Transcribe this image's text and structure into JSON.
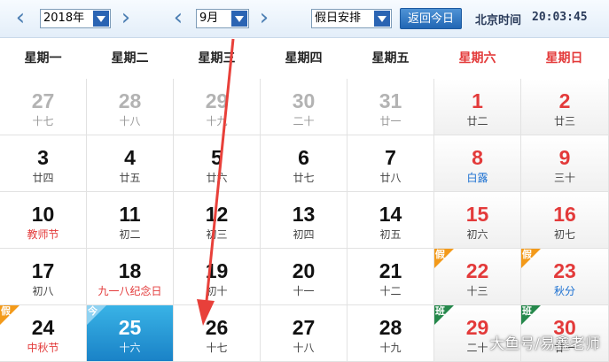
{
  "toolbar": {
    "year_value": "2018年",
    "month_value": "9月",
    "holiday_select": "假日安排",
    "today_button": "返回今日",
    "clock_label": "北京时间",
    "clock_time": "20:03:45"
  },
  "weekdays": [
    "星期一",
    "星期二",
    "星期三",
    "星期四",
    "星期五",
    "星期六",
    "星期日"
  ],
  "weeks": [
    [
      {
        "day": "27",
        "sub": "十七",
        "other": true
      },
      {
        "day": "28",
        "sub": "十八",
        "other": true
      },
      {
        "day": "29",
        "sub": "十九",
        "other": true
      },
      {
        "day": "30",
        "sub": "二十",
        "other": true
      },
      {
        "day": "31",
        "sub": "廿一",
        "other": true
      },
      {
        "day": "1",
        "sub": "廿二",
        "red": true
      },
      {
        "day": "2",
        "sub": "廿三",
        "red": true
      }
    ],
    [
      {
        "day": "3",
        "sub": "廿四"
      },
      {
        "day": "4",
        "sub": "廿五"
      },
      {
        "day": "5",
        "sub": "廿六"
      },
      {
        "day": "6",
        "sub": "廿七"
      },
      {
        "day": "7",
        "sub": "廿八"
      },
      {
        "day": "8",
        "sub": "白露",
        "red": true,
        "subColor": "blue"
      },
      {
        "day": "9",
        "sub": "三十",
        "red": true
      }
    ],
    [
      {
        "day": "10",
        "sub": "教师节",
        "subColor": "red"
      },
      {
        "day": "11",
        "sub": "初二"
      },
      {
        "day": "12",
        "sub": "初三"
      },
      {
        "day": "13",
        "sub": "初四"
      },
      {
        "day": "14",
        "sub": "初五"
      },
      {
        "day": "15",
        "sub": "初六",
        "red": true
      },
      {
        "day": "16",
        "sub": "初七",
        "red": true
      }
    ],
    [
      {
        "day": "17",
        "sub": "初八"
      },
      {
        "day": "18",
        "sub": "九一八纪念日",
        "subColor": "red"
      },
      {
        "day": "19",
        "sub": "初十"
      },
      {
        "day": "20",
        "sub": "十一"
      },
      {
        "day": "21",
        "sub": "十二"
      },
      {
        "day": "22",
        "sub": "十三",
        "red": true,
        "tag": "假",
        "tagType": "jia"
      },
      {
        "day": "23",
        "sub": "秋分",
        "red": true,
        "subColor": "blue",
        "tag": "假",
        "tagType": "jia"
      }
    ],
    [
      {
        "day": "24",
        "sub": "中秋节",
        "subColor": "red",
        "tag": "假",
        "tagType": "jia"
      },
      {
        "day": "25",
        "sub": "十六",
        "today": true,
        "tag": "今",
        "tagType": "jin"
      },
      {
        "day": "26",
        "sub": "十七"
      },
      {
        "day": "27",
        "sub": "十八"
      },
      {
        "day": "28",
        "sub": "十九"
      },
      {
        "day": "29",
        "sub": "二十",
        "red": true,
        "tag": "班",
        "tagType": "ban"
      },
      {
        "day": "30",
        "sub": "廿一",
        "red": true,
        "tag": "班",
        "tagType": "ban"
      }
    ]
  ],
  "watermark": "大鱼号/易鑫老师",
  "colors": {
    "accent": "#2b64b3",
    "weekend": "#e33a3a",
    "today": "#1a82c7",
    "holiday_tag": "#f39a1a",
    "workday_tag": "#25884b",
    "annotation_arrow": "#e8403a"
  }
}
